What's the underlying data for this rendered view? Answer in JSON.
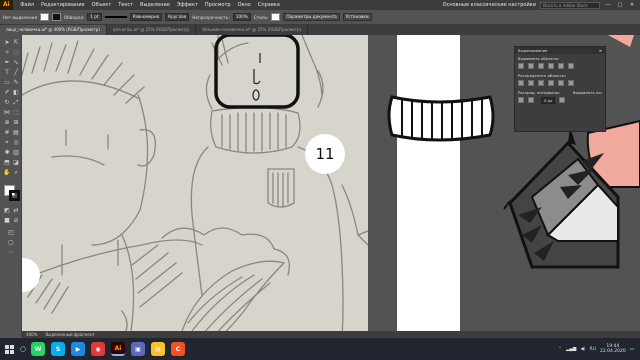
{
  "menubar": {
    "logo": "Ai",
    "items": [
      "Файл",
      "Редактирование",
      "Объект",
      "Текст",
      "Выделение",
      "Эффект",
      "Просмотр",
      "Окно",
      "Справка"
    ],
    "workspace": "Основные классические настройки",
    "search_placeholder": "Искать в Adobe Stock",
    "min": "—",
    "max": "□",
    "close": "✕"
  },
  "controlbar": {
    "selection_label": "Нет выделения",
    "stroke_label": "Обводка:",
    "stroke_value": "1 pt",
    "profile_value": "Равномерно",
    "brush_value": "Круглая",
    "opacity_label": "Непрозрачность:",
    "opacity_value": "100%",
    "style_label": "Стиль:",
    "doc_settings_button": "Параметры документа",
    "preferences_button": "Установки"
  },
  "tabs": [
    {
      "label": "лицо_человечка.ai* @ 400% (RGB/Просмотр)",
      "active": true
    },
    {
      "label": "для иглы.ai* @ 25% (RGB/Просмотр)",
      "active": false
    },
    {
      "label": "безымян-человечка.ai* @ 25% (RGB/Просмотр)",
      "active": false
    }
  ],
  "canvas": {
    "number_label": "11"
  },
  "align_panel": {
    "title": "Выравнивание",
    "align_objects_label": "Выровнять объекты:",
    "distribute_objects_label": "Распределить объекты:",
    "distribute_spacing_label": "Распред. интервалы:",
    "align_to_label": "Выровнять по:",
    "align_to_value": "Выд. объект"
  },
  "statusbar": {
    "zoom": "400%",
    "tool_hint": "Выделенный фрагмент"
  },
  "taskbar": {
    "apps": [
      {
        "icon": "whatsapp-icon",
        "label": "W",
        "color": "#25d366"
      },
      {
        "icon": "skype-icon",
        "label": "S",
        "color": "#00aff0"
      },
      {
        "icon": "video-icon",
        "label": "▶",
        "color": "#1e88e5"
      },
      {
        "icon": "chrome-icon",
        "label": "◉",
        "color": "#e53935"
      },
      {
        "icon": "illustrator-icon",
        "label": "Ai",
        "color": "#ff9a00"
      },
      {
        "icon": "photo-icon",
        "label": "▣",
        "color": "#5c6bc0"
      },
      {
        "icon": "folder-icon",
        "label": "▤",
        "color": "#fbc02d"
      },
      {
        "icon": "app-icon",
        "label": "C",
        "color": "#f4511e"
      }
    ],
    "language": "RU",
    "time": "19:44",
    "date": "22.04.2020"
  }
}
